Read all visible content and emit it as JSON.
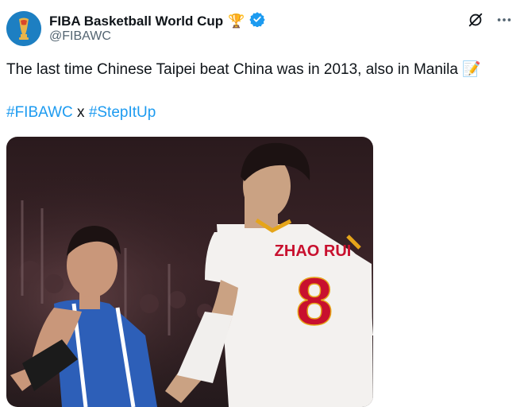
{
  "account": {
    "display_name": "FIBA Basketball World Cup",
    "handle": "@FIBAWC",
    "verified": true,
    "trophy_emoji": "🏆"
  },
  "tweet": {
    "text": "The last time Chinese Taipei beat China was in 2013, also in Manila",
    "emoji": "📝",
    "hashtags": [
      "#FIBAWC",
      "#StepItUp"
    ],
    "hashtag_separator": "x"
  },
  "media": {
    "jersey_name": "ZHAO RUI",
    "jersey_number": "8"
  },
  "colors": {
    "link": "#1d9bf0",
    "verified": "#1d9bf0",
    "text": "#0f1419",
    "secondary_text": "#536471",
    "jersey_red": "#c8102e"
  }
}
